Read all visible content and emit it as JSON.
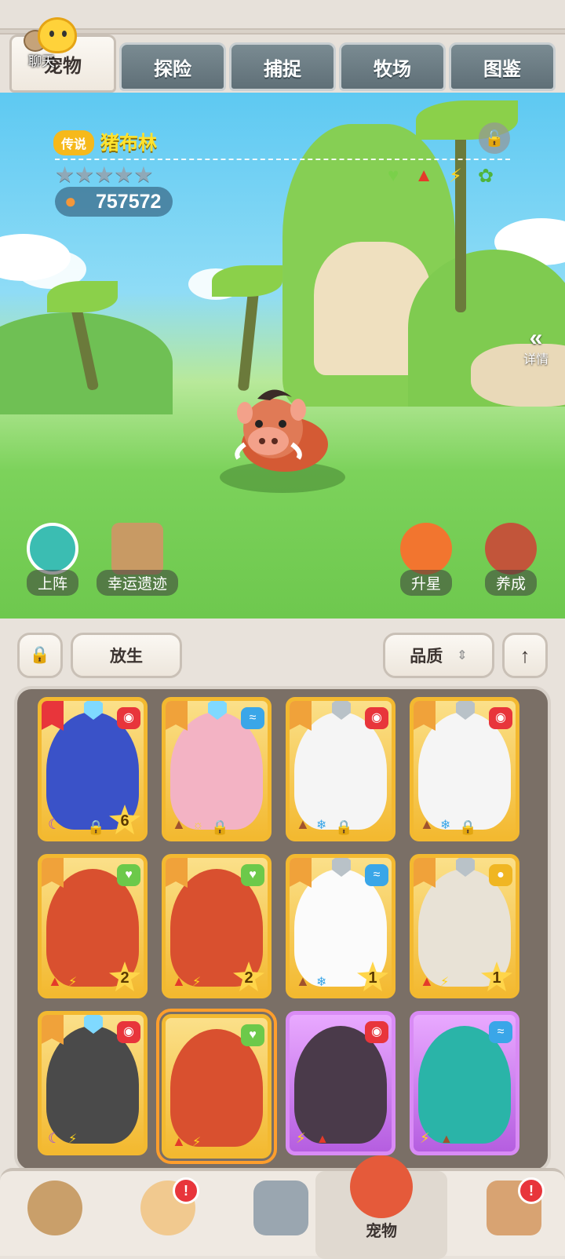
{
  "chat": {
    "label": "聊天"
  },
  "tabs": [
    {
      "label": "宠物",
      "active": true
    },
    {
      "label": "探险",
      "active": false
    },
    {
      "label": "捕捉",
      "active": false
    },
    {
      "label": "牧场",
      "active": false
    },
    {
      "label": "图鉴",
      "active": false
    }
  ],
  "pet": {
    "rarity": "传说",
    "name": "猪布林",
    "stars": "★★★★★",
    "power": "757572",
    "elements": [
      "leaf-heart-icon",
      "fire-icon",
      "lightning-icon",
      "leaf-icon"
    ],
    "locked": true
  },
  "detail": {
    "chevron": "«",
    "label": "详情"
  },
  "actions": {
    "deploy": "上阵",
    "ruins": "幸运遗迹",
    "star_up": "升星",
    "cultivate": "养成"
  },
  "list_controls": {
    "release": "放生",
    "sort": "品质",
    "sort_arrows": "⇕",
    "lock_icon": "🔒",
    "order_icon": "↑"
  },
  "cards": [
    {
      "name": "blue-armored-fox",
      "level": "6",
      "rarity": "gold",
      "locked": true
    },
    {
      "name": "pink-flying-squirrel",
      "level": "",
      "rarity": "gold",
      "locked": true
    },
    {
      "name": "panda-warrior",
      "level": "",
      "rarity": "gold",
      "locked": true
    },
    {
      "name": "panda-warrior",
      "level": "",
      "rarity": "gold",
      "locked": true
    },
    {
      "name": "boar",
      "level": "2",
      "rarity": "gold",
      "locked": false
    },
    {
      "name": "boar",
      "level": "2",
      "rarity": "gold",
      "locked": false
    },
    {
      "name": "white-fluffy-yeti",
      "level": "1",
      "rarity": "gold",
      "locked": false
    },
    {
      "name": "armored-beast",
      "level": "1",
      "rarity": "gold",
      "locked": false
    },
    {
      "name": "thunder-dragon",
      "level": "",
      "rarity": "gold",
      "locked": false
    },
    {
      "name": "boar",
      "level": "",
      "rarity": "gold",
      "locked": false,
      "selected": true
    },
    {
      "name": "crocodile-dragon",
      "level": "",
      "rarity": "purple",
      "locked": false
    },
    {
      "name": "teal-fish-bird",
      "level": "",
      "rarity": "purple",
      "locked": false
    }
  ],
  "bottom_nav": [
    {
      "name": "tribe",
      "label": "",
      "badge": false
    },
    {
      "name": "hero",
      "label": "",
      "badge": true
    },
    {
      "name": "equipment",
      "label": "",
      "badge": false
    },
    {
      "name": "pets",
      "label": "宠物",
      "badge": false,
      "active": true
    },
    {
      "name": "building",
      "label": "",
      "badge": true
    }
  ],
  "badge_symbol": "!"
}
